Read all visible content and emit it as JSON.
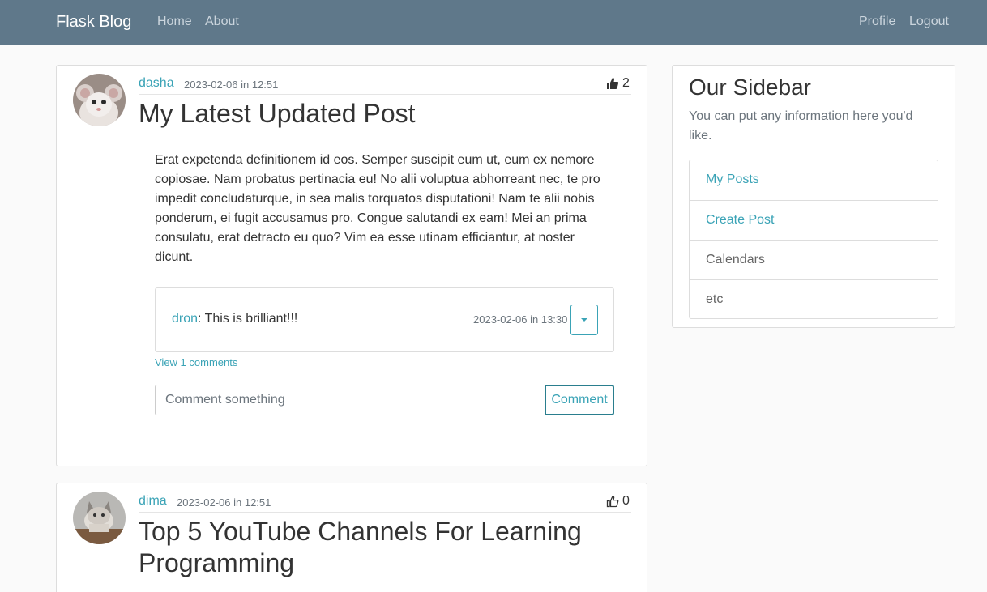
{
  "navbar": {
    "brand": "Flask Blog",
    "left_links": [
      "Home",
      "About"
    ],
    "right_links": [
      "Profile",
      "Logout"
    ]
  },
  "posts": [
    {
      "author": "dasha",
      "date": "2023-02-06 in 12:51",
      "likes": "2",
      "liked": true,
      "title": "My Latest Updated Post",
      "body": "Erat expetenda definitionem id eos. Semper suscipit eum ut, eum ex nemore copiosae. Nam probatus pertinacia eu! No alii voluptua abhorreant nec, te pro impedit concludaturque, in sea malis torquatos disputationi! Nam te alii nobis ponderum, ei fugit accusamus pro. Congue salutandi ex eam! Mei an prima consulatu, erat detracto eu quo? Vim ea esse utinam efficiantur, at noster dicunt.",
      "comment": {
        "author": "dron",
        "text": ": This is brilliant!!!",
        "date": "2023-02-06 in 13:30"
      },
      "view_comments": "View 1 comments",
      "comment_placeholder": "Comment something",
      "comment_button": "Comment"
    },
    {
      "author": "dima",
      "date": "2023-02-06 in 12:51",
      "likes": "0",
      "liked": false,
      "title": "Top 5 YouTube Channels For Learning Programming"
    }
  ],
  "sidebar": {
    "title": "Our Sidebar",
    "description": "You can put any information here you'd like.",
    "items": [
      {
        "label": "My Posts",
        "link": true
      },
      {
        "label": "Create Post",
        "link": true
      },
      {
        "label": "Calendars",
        "link": false
      },
      {
        "label": "etc",
        "link": false
      }
    ]
  },
  "colors": {
    "navbar": "#5f788a",
    "accent": "#3aa3b6",
    "background": "#fafafa"
  }
}
